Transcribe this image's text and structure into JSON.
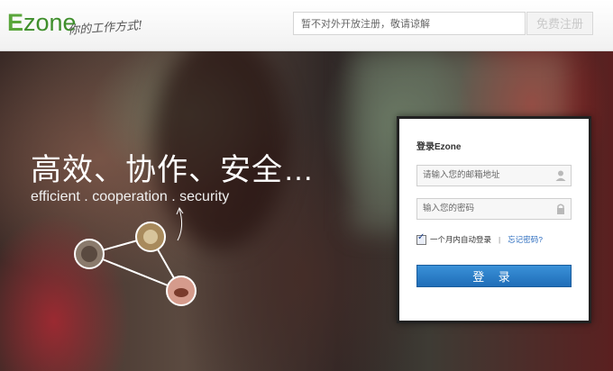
{
  "header": {
    "logo_e": "E",
    "logo_rest": "zone",
    "slogan": "你的工作方式!",
    "notice": "暂不对外开放注册，敬请谅解",
    "signup_label": "免费注册"
  },
  "hero": {
    "headline": "高效、协作、安全…",
    "tagline": "efficient . cooperation . security"
  },
  "login": {
    "title": "登录Ezone",
    "email_placeholder": "请输入您的邮箱地址",
    "password_placeholder": "输入您的密码",
    "remember_label": "一个月内自动登录",
    "separator": "|",
    "forgot_label": "忘记密码?",
    "submit_label": "登 录",
    "remember_checked": true
  },
  "colors": {
    "accent_blue": "#2a7cc6",
    "logo_green": "#3f8f2c"
  },
  "icons": [
    "user-icon",
    "lock-icon",
    "checkbox-checked-icon"
  ]
}
